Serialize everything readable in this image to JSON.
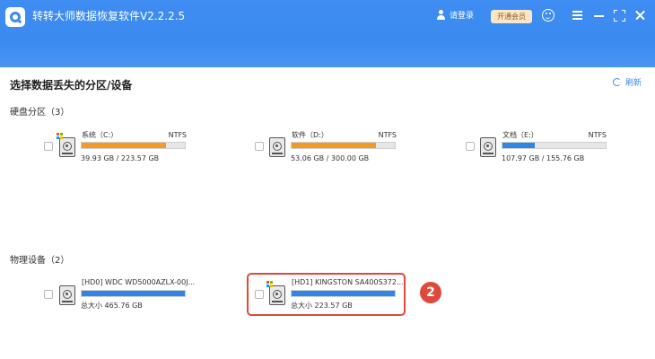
{
  "app": {
    "title": "转转大师数据恢复软件V2.2.2.5"
  },
  "header": {
    "login_label": "请登录",
    "vip_label": "开通会员",
    "icons": [
      "feedback-icon",
      "menu-icon",
      "minimize-icon",
      "maximize-icon",
      "close-icon"
    ]
  },
  "main": {
    "title": "选择数据丢失的分区/设备",
    "refresh_label": "刷新",
    "accent_color": "#3a8af0"
  },
  "partitions": {
    "title": "硬盘分区（3）",
    "items": [
      {
        "name": "系统（C:）",
        "fs": "NTFS",
        "usage": "39.93 GB / 223.57 GB",
        "fill_color": "#f29a26",
        "fill_fraction": 0.82
      },
      {
        "name": "软件（D:）",
        "fs": "NTFS",
        "usage": "53.06 GB / 300.00 GB",
        "fill_color": "#f29a26",
        "fill_fraction": 0.82
      },
      {
        "name": "文档（E:）",
        "fs": "NTFS",
        "usage": "107.97 GB / 155.76 GB",
        "fill_color": "#2f86e6",
        "fill_fraction": 0.31
      }
    ]
  },
  "devices": {
    "title": "物理设备（2）",
    "items": [
      {
        "name": "[HD0] WDC WD5000AZLX-00J...",
        "size": "总大小 465.76 GB",
        "fill_color": "#2f86e6",
        "fill_fraction": 1.0
      },
      {
        "name": "[HD1] KINGSTON SA400S372...",
        "size": "总大小 223.57 GB",
        "fill_color": "#2f86e6",
        "fill_fraction": 1.0
      }
    ]
  },
  "annotation": {
    "step": "2",
    "color": "#e0483a"
  }
}
